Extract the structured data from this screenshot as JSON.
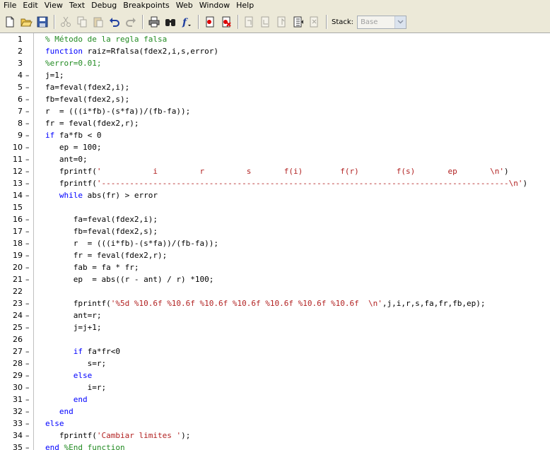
{
  "menu": [
    "File",
    "Edit",
    "View",
    "Text",
    "Debug",
    "Breakpoints",
    "Web",
    "Window",
    "Help"
  ],
  "toolbar": {
    "icons": [
      "new-file-icon",
      "open-folder-icon",
      "save-icon",
      "cut-icon",
      "copy-icon",
      "paste-icon",
      "undo-icon",
      "redo-icon",
      "print-icon",
      "find-icon",
      "function-icon",
      "set-breakpoint-icon",
      "clear-breakpoint-icon",
      "step-icon",
      "step-in-icon",
      "step-out-icon",
      "continue-icon",
      "exit-debug-icon"
    ],
    "stack_label": "Stack:",
    "stack_value": "Base"
  },
  "lines": [
    {
      "n": "1",
      "bp": "",
      "parts": [
        [
          "cm",
          "% Método de la regla falsa"
        ]
      ]
    },
    {
      "n": "2",
      "bp": "",
      "parts": [
        [
          "kw",
          "function"
        ],
        [
          "tx",
          " raiz=Rfalsa(fdex2,i,s,error)"
        ]
      ]
    },
    {
      "n": "3",
      "bp": "",
      "parts": [
        [
          "cm",
          "%error=0.01;"
        ]
      ]
    },
    {
      "n": "4",
      "bp": "–",
      "parts": [
        [
          "tx",
          "j=1;"
        ]
      ]
    },
    {
      "n": "5",
      "bp": "–",
      "parts": [
        [
          "tx",
          "fa=feval(fdex2,i);"
        ]
      ]
    },
    {
      "n": "6",
      "bp": "–",
      "parts": [
        [
          "tx",
          "fb=feval(fdex2,s);"
        ]
      ]
    },
    {
      "n": "7",
      "bp": "–",
      "parts": [
        [
          "tx",
          "r  = (((i*fb)-(s*fa))/(fb-fa));"
        ]
      ]
    },
    {
      "n": "8",
      "bp": "–",
      "parts": [
        [
          "tx",
          "fr = feval(fdex2,r);"
        ]
      ]
    },
    {
      "n": "9",
      "bp": "–",
      "parts": [
        [
          "kw",
          "if"
        ],
        [
          "tx",
          " fa*fb < 0"
        ]
      ]
    },
    {
      "n": "10",
      "bp": "–",
      "parts": [
        [
          "tx",
          "   ep = 100;"
        ]
      ]
    },
    {
      "n": "11",
      "bp": "–",
      "parts": [
        [
          "tx",
          "   ant=0;"
        ]
      ]
    },
    {
      "n": "12",
      "bp": "–",
      "parts": [
        [
          "tx",
          "   fprintf("
        ],
        [
          "st2",
          "'           i         r         s       f(i)        f(r)        f(s)       ep       \\n'"
        ],
        [
          "tx",
          ")"
        ]
      ]
    },
    {
      "n": "13",
      "bp": "–",
      "parts": [
        [
          "tx",
          "   fprintf("
        ],
        [
          "st2",
          "'---------------------------------------------------------------------------------------\\n'"
        ],
        [
          "tx",
          ")"
        ]
      ]
    },
    {
      "n": "14",
      "bp": "–",
      "parts": [
        [
          "tx",
          "   "
        ],
        [
          "kw",
          "while"
        ],
        [
          "tx",
          " abs(fr) > error"
        ]
      ]
    },
    {
      "n": "15",
      "bp": "",
      "parts": []
    },
    {
      "n": "16",
      "bp": "–",
      "parts": [
        [
          "tx",
          "      fa=feval(fdex2,i);"
        ]
      ]
    },
    {
      "n": "17",
      "bp": "–",
      "parts": [
        [
          "tx",
          "      fb=feval(fdex2,s);"
        ]
      ]
    },
    {
      "n": "18",
      "bp": "–",
      "parts": [
        [
          "tx",
          "      r  = (((i*fb)-(s*fa))/(fb-fa));"
        ]
      ]
    },
    {
      "n": "19",
      "bp": "–",
      "parts": [
        [
          "tx",
          "      fr = feval(fdex2,r);"
        ]
      ]
    },
    {
      "n": "20",
      "bp": "–",
      "parts": [
        [
          "tx",
          "      fab = fa * fr;"
        ]
      ]
    },
    {
      "n": "21",
      "bp": "–",
      "parts": [
        [
          "tx",
          "      ep  = abs((r - ant) / r) *100;"
        ]
      ]
    },
    {
      "n": "22",
      "bp": "",
      "parts": []
    },
    {
      "n": "23",
      "bp": "–",
      "parts": [
        [
          "tx",
          "      fprintf("
        ],
        [
          "st2",
          "'%5d %10.6f %10.6f %10.6f %10.6f %10.6f %10.6f %10.6f  \\n'"
        ],
        [
          "tx",
          ",j,i,r,s,fa,fr,fb,ep);"
        ]
      ]
    },
    {
      "n": "24",
      "bp": "–",
      "parts": [
        [
          "tx",
          "      ant=r;"
        ]
      ]
    },
    {
      "n": "25",
      "bp": "–",
      "parts": [
        [
          "tx",
          "      j=j+1;"
        ]
      ]
    },
    {
      "n": "26",
      "bp": "",
      "parts": []
    },
    {
      "n": "27",
      "bp": "–",
      "parts": [
        [
          "tx",
          "      "
        ],
        [
          "kw",
          "if"
        ],
        [
          "tx",
          " fa*fr<0"
        ]
      ]
    },
    {
      "n": "28",
      "bp": "–",
      "parts": [
        [
          "tx",
          "         s=r;"
        ]
      ]
    },
    {
      "n": "29",
      "bp": "–",
      "parts": [
        [
          "tx",
          "      "
        ],
        [
          "kw",
          "else"
        ]
      ]
    },
    {
      "n": "30",
      "bp": "–",
      "parts": [
        [
          "tx",
          "         i=r;"
        ]
      ]
    },
    {
      "n": "31",
      "bp": "–",
      "parts": [
        [
          "tx",
          "      "
        ],
        [
          "kw",
          "end"
        ]
      ]
    },
    {
      "n": "32",
      "bp": "–",
      "parts": [
        [
          "tx",
          "   "
        ],
        [
          "kw",
          "end"
        ]
      ]
    },
    {
      "n": "33",
      "bp": "–",
      "parts": [
        [
          "kw",
          "else"
        ]
      ]
    },
    {
      "n": "34",
      "bp": "–",
      "parts": [
        [
          "tx",
          "   fprintf("
        ],
        [
          "st2",
          "'Cambiar limites '"
        ],
        [
          "tx",
          ");"
        ]
      ]
    },
    {
      "n": "35",
      "bp": "–",
      "parts": [
        [
          "kw",
          "end"
        ],
        [
          "tx",
          " "
        ],
        [
          "cm",
          "%End function"
        ]
      ]
    }
  ]
}
